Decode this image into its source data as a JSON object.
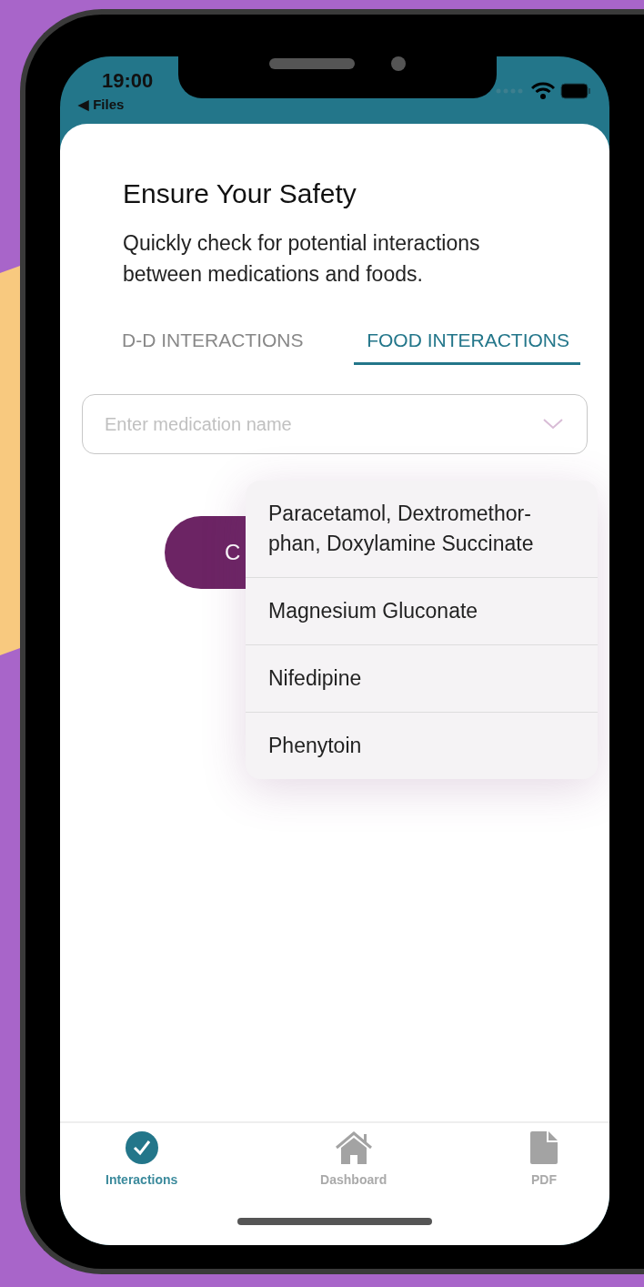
{
  "status_bar": {
    "time": "19:00",
    "back_link": "◀ Files"
  },
  "header": {
    "title": "Ensure Your Safety",
    "subtitle": "Quickly check for potential interactions between medications and foods."
  },
  "tabs": [
    {
      "label": "D-D INTERACTIONS",
      "selected": false
    },
    {
      "label": "FOOD INTERACTIONS",
      "selected": true
    }
  ],
  "search": {
    "placeholder": "Enter medication name"
  },
  "check_button": {
    "label": "C"
  },
  "dropdown": {
    "options": [
      "Paracetamol, Dextromethor-phan, Doxylamine Succinate",
      "Magnesium Gluconate",
      "Nifedipine",
      "Phenytoin"
    ]
  },
  "bottom_nav": [
    {
      "kind": "check",
      "label": "Interactions",
      "selected": true
    },
    {
      "kind": "home",
      "label": "Dashboard",
      "selected": false
    },
    {
      "kind": "file",
      "label": "PDF",
      "selected": false
    }
  ]
}
